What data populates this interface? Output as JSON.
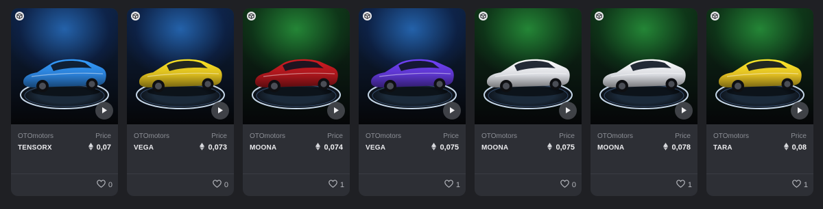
{
  "colors": {
    "page_bg": "#1f2024",
    "card_bg": "#2d2f35",
    "text_muted": "#8c8f96",
    "text_primary": "#e9e9ec"
  },
  "icons": {
    "collection": "cube-badge-icon",
    "play": "play-icon",
    "currency": "ethereum-icon",
    "like": "heart-icon"
  },
  "cards": [
    {
      "brand": "OTOmotors",
      "price_label": "Price",
      "model": "TENSORX",
      "price": "0,07",
      "likes": "0",
      "bg": "blue",
      "car_color": "#2a7ed4"
    },
    {
      "brand": "OTOmotors",
      "price_label": "Price",
      "model": "VEGA",
      "price": "0,073",
      "likes": "0",
      "bg": "blue",
      "car_color": "#d8b91e"
    },
    {
      "brand": "OTOmotors",
      "price_label": "Price",
      "model": "MOONA",
      "price": "0,074",
      "likes": "1",
      "bg": "green",
      "car_color": "#a8161c"
    },
    {
      "brand": "OTOmotors",
      "price_label": "Price",
      "model": "VEGA",
      "price": "0,075",
      "likes": "1",
      "bg": "blue",
      "car_color": "#5b35c9"
    },
    {
      "brand": "OTOmotors",
      "price_label": "Price",
      "model": "MOONA",
      "price": "0,075",
      "likes": "0",
      "bg": "green",
      "car_color": "#d9dbe0"
    },
    {
      "brand": "OTOmotors",
      "price_label": "Price",
      "model": "MOONA",
      "price": "0,078",
      "likes": "1",
      "bg": "green",
      "car_color": "#d9dbe0"
    },
    {
      "brand": "OTOmotors",
      "price_label": "Price",
      "model": "TARA",
      "price": "0,08",
      "likes": "1",
      "bg": "green",
      "car_color": "#e0bd22"
    }
  ]
}
